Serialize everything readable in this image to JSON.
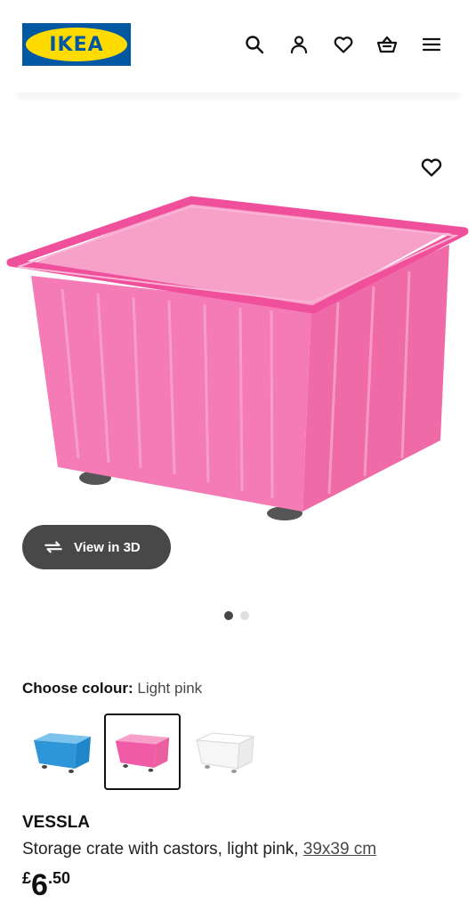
{
  "header": {
    "logo_text": "IKEA",
    "icons": [
      "search-icon",
      "profile-icon",
      "heart-icon",
      "basket-icon",
      "menu-icon"
    ],
    "colors": {
      "logo_blue": "#0058a3",
      "logo_yellow": "#ffdb00"
    }
  },
  "gallery": {
    "view_3d_label": "View in 3D",
    "dots_total": 2,
    "active_dot": 1
  },
  "colour": {
    "label": "Choose colour:",
    "selected": "Light pink",
    "options": [
      {
        "name": "blue",
        "color": "#2e96d8"
      },
      {
        "name": "light pink",
        "color": "#f05aa6"
      },
      {
        "name": "white",
        "color": "#f4f4f4"
      }
    ],
    "selected_index": 1
  },
  "product": {
    "name": "VESSLA",
    "description": "Storage crate with castors, light pink, ",
    "size": "39x39 cm",
    "price": {
      "currency": "£",
      "integer": "6",
      "decimal": ".50"
    },
    "crate_color": "#f26aa9"
  }
}
